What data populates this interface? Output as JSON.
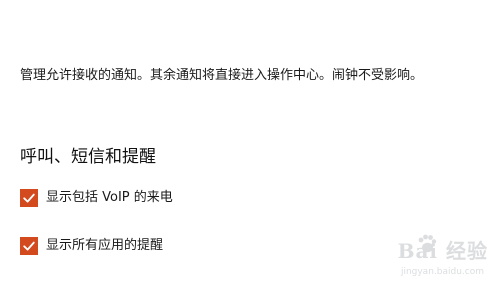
{
  "description": "管理允许接收的通知。其余通知将直接进入操作中心。闹钟不受影响。",
  "section_title": "呼叫、短信和提醒",
  "options": [
    {
      "label": "显示包括 VoIP 的来电",
      "checked": true
    },
    {
      "label": "显示所有应用的提醒",
      "checked": true
    }
  ],
  "colors": {
    "accent": "#d24a1e",
    "background": "#ffffff",
    "text": "#1a1a1a"
  },
  "watermark": {
    "main": "Bai 经验",
    "sub": "jingyan.baidu.com"
  }
}
